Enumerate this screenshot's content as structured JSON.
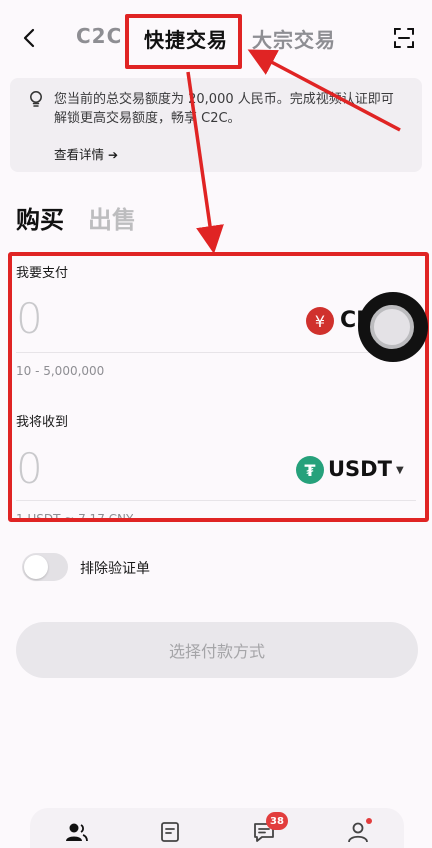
{
  "header": {
    "tabs": [
      "C2C",
      "快捷交易",
      "大宗交易"
    ],
    "active_tab": "快捷交易"
  },
  "notice": {
    "text": "您当前的总交易额度为 20,000 人民币。完成视频认证即可解锁更高交易额度，畅享 C2C。",
    "link_label": "查看详情",
    "link_arrow": "➔"
  },
  "mode": {
    "buy_label": "购买",
    "sell_label": "出售"
  },
  "pay": {
    "label": "我要支付",
    "amount": "0",
    "currency_symbol": "¥",
    "currency": "CN",
    "range": "10 - 5,000,000"
  },
  "receive": {
    "label": "我将收到",
    "amount": "0",
    "currency_symbol": "₮",
    "currency": "USDT",
    "caret": "▼",
    "rate": "1 USDT ≈ 7.17 CNY"
  },
  "options": {
    "exclude_verified_label": "排除验证单",
    "exclude_verified_on": false
  },
  "cta": {
    "label": "选择付款方式"
  },
  "bottom_nav": {
    "items": [
      "p2p-icon",
      "orders-icon",
      "chat-icon",
      "profile-icon"
    ],
    "chat_badge": "38"
  },
  "colors": {
    "annotation_red": "#e02424",
    "cny_red": "#d0312d",
    "usdt_green": "#26a17b"
  }
}
